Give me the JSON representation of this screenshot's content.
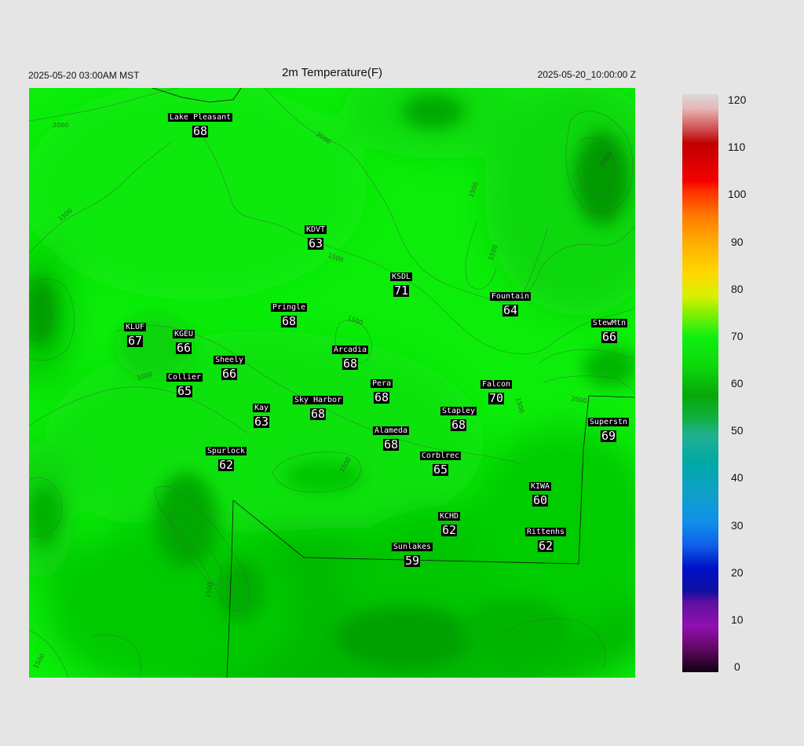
{
  "header": {
    "local_time": "2025-05-20 03:00AM MST",
    "title": "2m Temperature(F)",
    "utc_time": "2025-05-20_10:00:00 Z"
  },
  "contour_labels": [
    "2000",
    "2000",
    "1500",
    "1500",
    "1500",
    "1500",
    "1000",
    "2000",
    "1500",
    "2000",
    "1500",
    "1500",
    "1500",
    "1500"
  ],
  "stations": [
    {
      "name": "Lake Pleasant",
      "temp": "68"
    },
    {
      "name": "KDVT",
      "temp": "63"
    },
    {
      "name": "KSDL",
      "temp": "71"
    },
    {
      "name": "Fountain",
      "temp": "64"
    },
    {
      "name": "StewMtn",
      "temp": "66"
    },
    {
      "name": "Pringle",
      "temp": "68"
    },
    {
      "name": "KLUF",
      "temp": "67"
    },
    {
      "name": "KGEU",
      "temp": "66"
    },
    {
      "name": "Arcadia",
      "temp": "68"
    },
    {
      "name": "Sheely",
      "temp": "66"
    },
    {
      "name": "Collier",
      "temp": "65"
    },
    {
      "name": "Pera",
      "temp": "68"
    },
    {
      "name": "Falcon",
      "temp": "70"
    },
    {
      "name": "Kay",
      "temp": "63"
    },
    {
      "name": "Sky Harbor",
      "temp": "68"
    },
    {
      "name": "Stapley",
      "temp": "68"
    },
    {
      "name": "Superstn",
      "temp": "69"
    },
    {
      "name": "Alameda",
      "temp": "68"
    },
    {
      "name": "Spurlock",
      "temp": "62"
    },
    {
      "name": "Corblrec",
      "temp": "65"
    },
    {
      "name": "KIWA",
      "temp": "60"
    },
    {
      "name": "KCHD",
      "temp": "62"
    },
    {
      "name": "Rittenhs",
      "temp": "62"
    },
    {
      "name": "Sunlakes",
      "temp": "59"
    }
  ],
  "colorbar": {
    "ticks": [
      "120",
      "110",
      "100",
      "90",
      "80",
      "70",
      "60",
      "50",
      "40",
      "30",
      "20",
      "10",
      "0"
    ],
    "min": 0,
    "max": 120
  }
}
